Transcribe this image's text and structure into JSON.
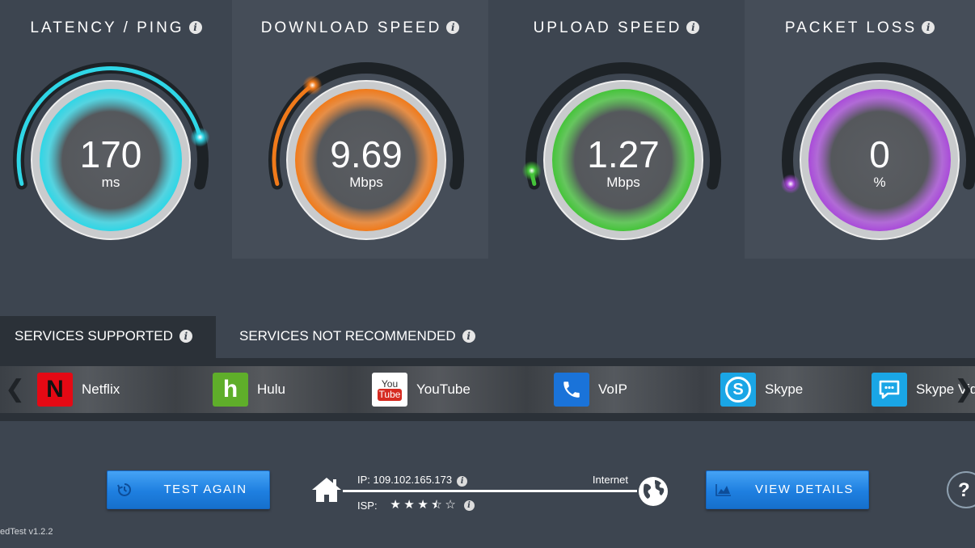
{
  "colors": {
    "background": "#3d4550",
    "panel_alt": "#454d58",
    "latency": "#2fd6e6",
    "download": "#f07a1a",
    "upload": "#45c43a",
    "packet_loss": "#a94bd9",
    "button": "#1e7fe0"
  },
  "gauges": [
    {
      "title": "LATENCY / PING",
      "value": "170",
      "unit": "ms",
      "fill_fraction": 0.86,
      "color": "#2fd6e6"
    },
    {
      "title": "DOWNLOAD SPEED",
      "value": "9.69",
      "unit": "Mbps",
      "fill_fraction": 0.33,
      "color": "#f07a1a"
    },
    {
      "title": "UPLOAD SPEED",
      "value": "1.27",
      "unit": "Mbps",
      "fill_fraction": 0.04,
      "color": "#45c43a"
    },
    {
      "title": "PACKET LOSS",
      "value": "0",
      "unit": "%",
      "fill_fraction": 0.0,
      "color": "#a94bd9"
    }
  ],
  "tabs": {
    "supported": "SERVICES SUPPORTED",
    "not_recommended": "SERVICES NOT RECOMMENDED"
  },
  "services": [
    {
      "name": "Netflix",
      "icon": "netflix-icon",
      "icon_text": "N"
    },
    {
      "name": "Hulu",
      "icon": "hulu-icon",
      "icon_text": "h"
    },
    {
      "name": "YouTube",
      "icon": "youtube-icon",
      "icon_text_top": "You",
      "icon_text_bottom": "Tube"
    },
    {
      "name": "VoIP",
      "icon": "phone-icon"
    },
    {
      "name": "Skype",
      "icon": "skype-icon",
      "icon_text": "S"
    },
    {
      "name": "Skype Vid",
      "icon": "video-chat-icon"
    }
  ],
  "buttons": {
    "test_again": "TEST AGAIN",
    "view_details": "VIEW DETAILS",
    "help": "?"
  },
  "connection": {
    "ip": "IP: 109.102.165.173",
    "internet": "Internet",
    "isp_label": "ISP:",
    "isp_rating": 3.5,
    "isp_rating_max": 5
  },
  "version": "edTest v1.2.2"
}
